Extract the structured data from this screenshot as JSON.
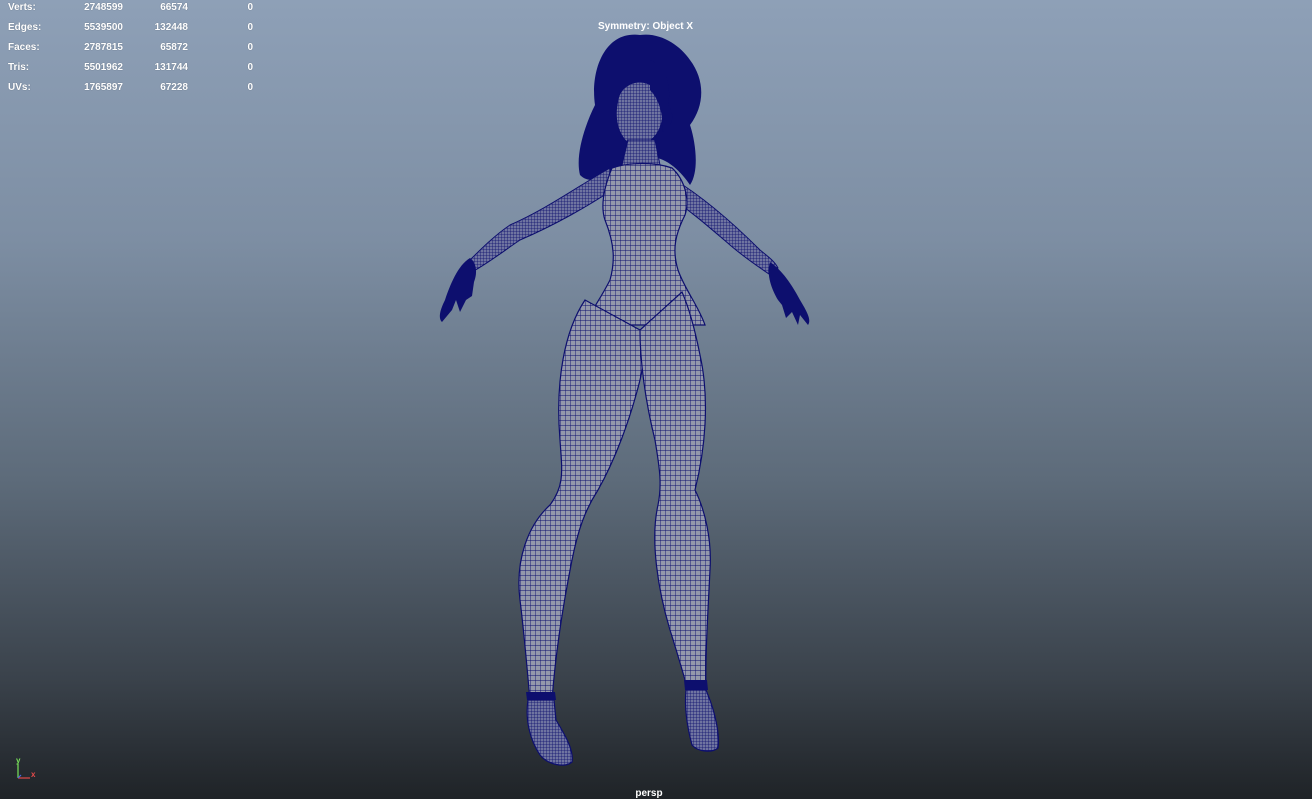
{
  "hud": {
    "rows": [
      {
        "label": "Verts:",
        "c1": "2748599",
        "c2": "66574",
        "c3": "0"
      },
      {
        "label": "Edges:",
        "c1": "5539500",
        "c2": "132448",
        "c3": "0"
      },
      {
        "label": "Faces:",
        "c1": "2787815",
        "c2": "65872",
        "c3": "0"
      },
      {
        "label": "Tris:",
        "c1": "5501962",
        "c2": "131744",
        "c3": "0"
      },
      {
        "label": "UVs:",
        "c1": "1765897",
        "c2": "67228",
        "c3": "0"
      }
    ]
  },
  "viewport": {
    "symmetry_label": "Symmetry: Object X",
    "camera_name": "persp"
  },
  "axis": {
    "y_label": "y",
    "x_label": "x",
    "y_color": "#79e35a",
    "x_color": "#e24a4a"
  },
  "colors": {
    "wireframe": "#0d0f6e",
    "mesh_fill": "#8e94a8",
    "background_top": "#8ea0b7",
    "background_bottom": "#1f2327"
  }
}
